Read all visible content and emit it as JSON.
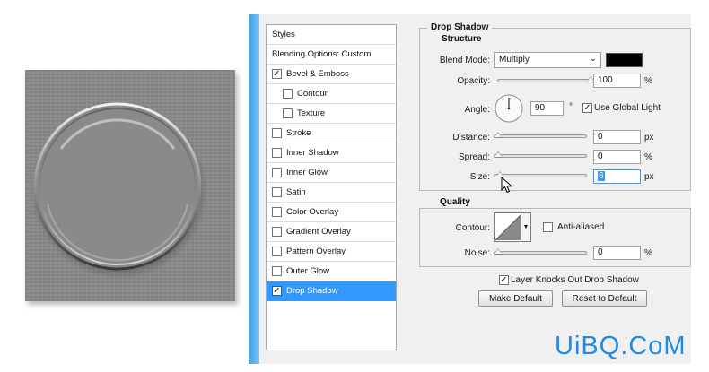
{
  "styles_panel": {
    "header": "Styles",
    "items": [
      {
        "label": "Blending Options: Custom",
        "checkbox": false,
        "checked": false,
        "indent": false,
        "selected": false
      },
      {
        "label": "Bevel & Emboss",
        "checkbox": true,
        "checked": true,
        "indent": false,
        "selected": false
      },
      {
        "label": "Contour",
        "checkbox": true,
        "checked": false,
        "indent": true,
        "selected": false
      },
      {
        "label": "Texture",
        "checkbox": true,
        "checked": false,
        "indent": true,
        "selected": false
      },
      {
        "label": "Stroke",
        "checkbox": true,
        "checked": false,
        "indent": false,
        "selected": false
      },
      {
        "label": "Inner Shadow",
        "checkbox": true,
        "checked": false,
        "indent": false,
        "selected": false
      },
      {
        "label": "Inner Glow",
        "checkbox": true,
        "checked": false,
        "indent": false,
        "selected": false
      },
      {
        "label": "Satin",
        "checkbox": true,
        "checked": false,
        "indent": false,
        "selected": false
      },
      {
        "label": "Color Overlay",
        "checkbox": true,
        "checked": false,
        "indent": false,
        "selected": false
      },
      {
        "label": "Gradient Overlay",
        "checkbox": true,
        "checked": false,
        "indent": false,
        "selected": false
      },
      {
        "label": "Pattern Overlay",
        "checkbox": true,
        "checked": false,
        "indent": false,
        "selected": false
      },
      {
        "label": "Outer Glow",
        "checkbox": true,
        "checked": false,
        "indent": false,
        "selected": false
      },
      {
        "label": "Drop Shadow",
        "checkbox": true,
        "checked": true,
        "indent": false,
        "selected": true
      }
    ]
  },
  "drop_shadow": {
    "title": "Drop Shadow",
    "structure": {
      "title": "Structure",
      "blend_mode_label": "Blend Mode:",
      "blend_mode_value": "Multiply",
      "shadow_color": "#000000",
      "opacity_label": "Opacity:",
      "opacity_value": "100",
      "opacity_unit": "%",
      "opacity_level": 1.0,
      "angle_label": "Angle:",
      "angle_value": "90",
      "angle_unit": "°",
      "use_global_light_label": "Use Global Light",
      "use_global_light_checked": true,
      "distance_label": "Distance:",
      "distance_value": "0",
      "distance_unit": "px",
      "distance_level": 0,
      "spread_label": "Spread:",
      "spread_value": "0",
      "spread_unit": "%",
      "spread_level": 0,
      "size_label": "Size:",
      "size_value": "6",
      "size_unit": "px",
      "size_level": 0.02
    },
    "quality": {
      "title": "Quality",
      "contour_label": "Contour:",
      "anti_aliased_label": "Anti-aliased",
      "anti_aliased_checked": false,
      "noise_label": "Noise:",
      "noise_value": "0",
      "noise_unit": "%",
      "noise_level": 0
    },
    "layer_knocks_out_label": "Layer Knocks Out Drop Shadow",
    "layer_knocks_out_checked": true,
    "make_default_label": "Make Default",
    "reset_to_default_label": "Reset to Default"
  },
  "colors": {
    "selection": "#3399ff",
    "preview_bg": "#8b8b8b",
    "watermark": "#1f8be6"
  },
  "watermark": "UiBQ.CoM"
}
